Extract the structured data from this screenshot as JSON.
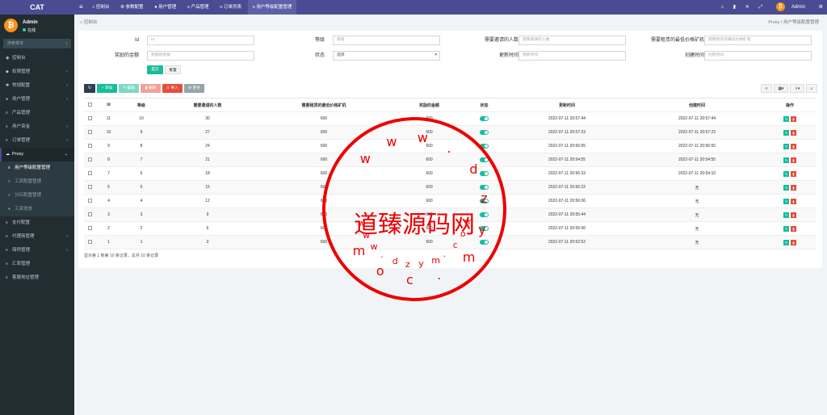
{
  "app": {
    "logo": "CAT",
    "user": "Admin",
    "status": "在线",
    "search_placeholder": "搜索菜单"
  },
  "sidebar": {
    "items": [
      "控制台",
      "权限管理",
      "常规配置",
      "用户管理",
      "产品管理",
      "用户资金",
      "订单管理",
      "Proxy",
      "用户等级配置管理",
      "工资配置管理",
      "分红配置管理",
      "工资发放",
      "支付配置",
      "代理商管理",
      "简称管理",
      "汇率管理",
      "客服地址管理"
    ]
  },
  "topbar": {
    "tabs": [
      "控制台",
      "参数配置",
      "用户管理",
      "产品管理",
      "订单列表",
      "用户等级配置管理"
    ],
    "user": "Admin"
  },
  "breadcrumb": {
    "left": "控制台",
    "right": "Proxy / 用户等级配置管理"
  },
  "filters": {
    "labels": [
      "Id",
      "等级",
      "需要邀请的人数",
      "需要租赁的最低价格矿机",
      "奖励的金额",
      "状态",
      "更新时间",
      "创建时间"
    ],
    "placeholders": [
      "Id",
      "等级",
      "需要邀请的人数",
      "需要租赁的最低价格矿机",
      "奖励的金额",
      "选择",
      "更新时间",
      "创建时间"
    ],
    "submit": "提交",
    "reset": "重置"
  },
  "toolbar": {
    "add": "添加",
    "edit": "编辑",
    "delete": "删除",
    "import": "导入",
    "more": "更多"
  },
  "table": {
    "headers": [
      "Id",
      "等级",
      "需要邀请的人数",
      "需要租赁的最低价格矿机",
      "奖励的金额",
      "状态",
      "更新时间",
      "创建时间",
      "操作"
    ],
    "rows": [
      [
        "11",
        "10",
        "30",
        "600",
        "600",
        "2022-07-11 20:57:44",
        "2022-07-11 20:57:44"
      ],
      [
        "10",
        "9",
        "27",
        "600",
        "600",
        "2022-07-11 20:57:23",
        "2022-07-11 20:57:23"
      ],
      [
        "9",
        "8",
        "24",
        "600",
        "600",
        "2022-07-11 20:56:55",
        "2022-07-11 20:56:55"
      ],
      [
        "8",
        "7",
        "21",
        "600",
        "600",
        "2022-07-11 20:54:55",
        "2022-07-11 20:54:55"
      ],
      [
        "7",
        "6",
        "18",
        "600",
        "600",
        "2022-07-11 20:56:33",
        "2022-07-11 20:54:10"
      ],
      [
        "5",
        "5",
        "15",
        "600",
        "600",
        "2022-07-11 20:56:22",
        "无"
      ],
      [
        "4",
        "4",
        "12",
        "600",
        "600",
        "2022-07-11 20:56:06",
        "无"
      ],
      [
        "3",
        "3",
        "9",
        "600",
        "600",
        "2022-07-11 20:55:44",
        "无"
      ],
      [
        "2",
        "2",
        "6",
        "600",
        "600",
        "2022-07-11 20:55:06",
        "无"
      ],
      [
        "1",
        "1",
        "3",
        "600",
        "600",
        "2022-07-11 20:52:52",
        "无"
      ]
    ]
  },
  "footer": "显示第 1 到第 10 条记录，总共 10 条记录",
  "watermark": {
    "text": "道臻源码网",
    "url_top": "www.dzym.com",
    "url_bottom": "www.dzym.com"
  },
  "colors": {
    "brand": "#4a4c93",
    "success": "#18bc9c",
    "danger": "#e74c3c"
  }
}
